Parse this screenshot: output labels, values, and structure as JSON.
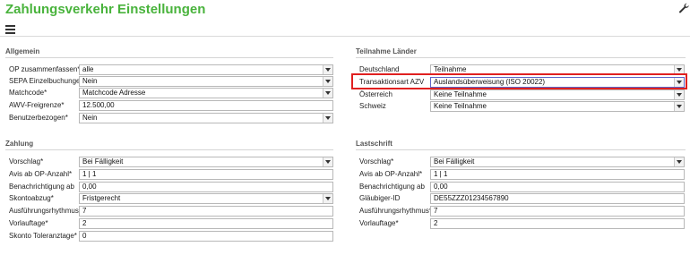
{
  "page": {
    "title": "Zahlungsverkehr Einstellungen"
  },
  "toolbar": {
    "menu_icon": "hamburger-menu-icon",
    "settings_icon": "wrench-icon"
  },
  "accent_color": "#49b33c",
  "allgemein": {
    "heading": "Allgemein",
    "fields": [
      {
        "label": "OP zusammenfassen*",
        "value": "alle",
        "type": "select"
      },
      {
        "label": "SEPA Einzelbuchungen*",
        "value": "Nein",
        "type": "select"
      },
      {
        "label": "Matchcode*",
        "value": "Matchcode Adresse",
        "type": "select"
      },
      {
        "label": "AWV-Freigrenze*",
        "value": "12.500,00",
        "type": "input"
      },
      {
        "label": "Benutzerbezogen*",
        "value": "Nein",
        "type": "select"
      }
    ]
  },
  "teilnahme": {
    "heading": "Teilnahme Länder",
    "fields": [
      {
        "label": "Deutschland",
        "value": "Teilnahme",
        "type": "select"
      },
      {
        "label": "Transaktionsart AZV",
        "value": "Auslandsüberweisung (ISO 20022)",
        "type": "select"
      },
      {
        "label": "Österreich",
        "value": "Keine Teilnahme",
        "type": "select"
      },
      {
        "label": "Schweiz",
        "value": "Keine Teilnahme",
        "type": "select"
      }
    ]
  },
  "zahlung": {
    "heading": "Zahlung",
    "fields": [
      {
        "label": "Vorschlag*",
        "value": "Bei Fälligkeit",
        "type": "select"
      },
      {
        "label": "Avis ab OP-Anzahl*",
        "value": "1 | 1",
        "type": "input"
      },
      {
        "label": "Benachrichtigung ab",
        "value": "0,00",
        "type": "input"
      },
      {
        "label": "Skontoabzug*",
        "value": "Fristgerecht",
        "type": "select"
      },
      {
        "label": "Ausführungsrhythmus*",
        "value": "7",
        "type": "input"
      },
      {
        "label": "Vorlauftage*",
        "value": "2",
        "type": "input"
      },
      {
        "label": "Skonto Toleranztage*",
        "value": "0",
        "type": "input"
      }
    ]
  },
  "lastschrift": {
    "heading": "Lastschrift",
    "fields": [
      {
        "label": "Vorschlag*",
        "value": "Bei Fälligkeit",
        "type": "select"
      },
      {
        "label": "Avis ab OP-Anzahl*",
        "value": "1 | 1",
        "type": "input"
      },
      {
        "label": "Benachrichtigung ab",
        "value": "0,00",
        "type": "input"
      },
      {
        "label": "Gläubiger-ID",
        "value": "DE55ZZZ01234567890",
        "type": "input"
      },
      {
        "label": "Ausführungsrhythmus*",
        "value": "7",
        "type": "input"
      },
      {
        "label": "Vorlauftage*",
        "value": "2",
        "type": "input"
      }
    ]
  }
}
